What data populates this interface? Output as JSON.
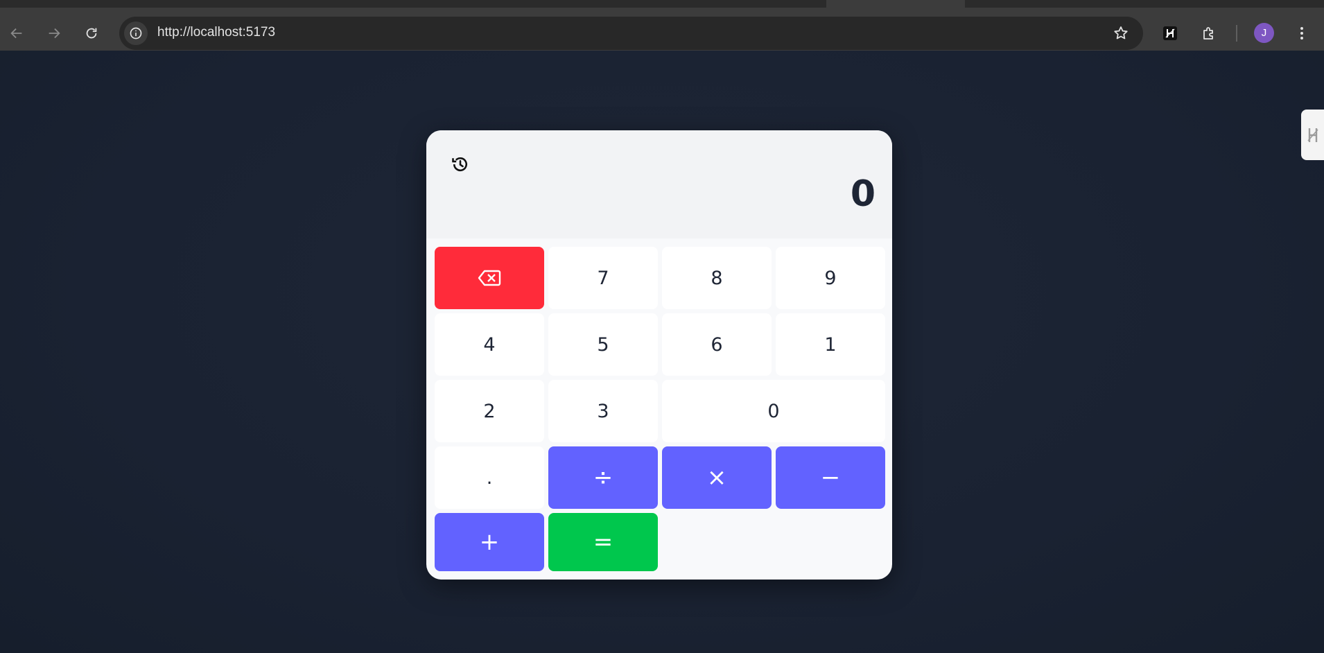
{
  "browser": {
    "url": "http://localhost:5173",
    "profile_initial": "J",
    "icons": [
      "back-arrow-icon",
      "forward-arrow-icon",
      "reload-icon",
      "site-info-icon",
      "bookmark-star-icon",
      "extension-h-icon",
      "puzzle-extensions-icon",
      "kebab-menu-icon"
    ]
  },
  "calculator": {
    "display_value": "0",
    "history_icon": "history-clock-icon",
    "keys": {
      "backspace_icon": "backspace-icon",
      "k7": "7",
      "k8": "8",
      "k9": "9",
      "k4": "4",
      "k5": "5",
      "k6": "6",
      "k1": "1",
      "k2": "2",
      "k3": "3",
      "k0": "0",
      "dot": ".",
      "divide": "÷",
      "multiply": "×",
      "minus": "−",
      "plus": "+",
      "equals": "="
    },
    "colors": {
      "operator": "#6262ff",
      "backspace": "#ff2b3a",
      "equals": "#00c74d",
      "number": "#ffffff",
      "text": "#1e2535"
    }
  }
}
